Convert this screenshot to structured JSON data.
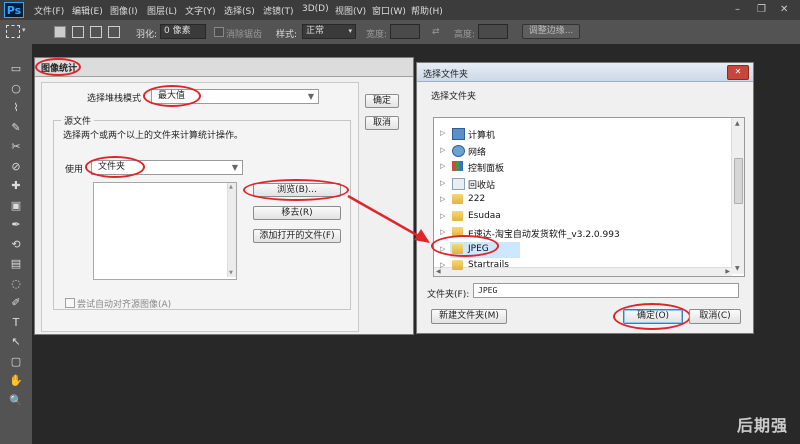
{
  "app": {
    "logo": "Ps"
  },
  "menu": [
    "文件(F)",
    "编辑(E)",
    "图像(I)",
    "图层(L)",
    "文字(Y)",
    "选择(S)",
    "滤镜(T)",
    "3D(D)",
    "视图(V)",
    "窗口(W)",
    "帮助(H)"
  ],
  "window_controls": {
    "minimize": "–",
    "restore": "❐",
    "close": "✕"
  },
  "options": {
    "feather_label": "羽化:",
    "feather_value": "0 像素",
    "antialias_label": "消除锯齿",
    "style_label": "样式:",
    "style_value": "正常",
    "width_label": "宽度:",
    "height_label": "高度:",
    "refine_edge": "调整边缘..."
  },
  "stats_dialog": {
    "title": "图像统计",
    "stack_mode_label": "选择堆栈模式",
    "stack_mode_value": "最大值",
    "ok_label": "确定",
    "cancel_label": "取消",
    "source_group_label": "源文件",
    "source_hint": "选择两个或两个以上的文件来计算统计操作。",
    "use_label": "使用",
    "use_value": "文件夹",
    "browse_label": "浏览(B)...",
    "remove_label": "移去(R)",
    "add_open_label": "添加打开的文件(F)",
    "auto_align_label": "尝试自动对齐源图像(A)"
  },
  "folder_dialog": {
    "title": "选择文件夹",
    "heading": "选择文件夹",
    "tree": [
      {
        "name": "计算机",
        "icon": "computer-icon"
      },
      {
        "name": "网络",
        "icon": "network-icon"
      },
      {
        "name": "控制面板",
        "icon": "control-panel-icon"
      },
      {
        "name": "回收站",
        "icon": "recycle-bin-icon"
      },
      {
        "name": "222",
        "icon": "folder-icon"
      },
      {
        "name": "Esudaa",
        "icon": "folder-icon"
      },
      {
        "name": "E速达-淘宝自动发货软件_v3.2.0.993",
        "icon": "folder-icon"
      },
      {
        "name": "JPEG",
        "icon": "folder-icon",
        "selected": true
      },
      {
        "name": "Startrails",
        "icon": "folder-icon"
      }
    ],
    "folder_label": "文件夹(F):",
    "folder_value": "JPEG",
    "new_folder_label": "新建文件夹(M)",
    "ok_label": "确定(O)",
    "cancel_label": "取消(C)",
    "close_glyph": "✕"
  },
  "toolbar_glyphs": [
    "▭",
    "○",
    "⌇",
    "✎",
    "✂",
    "⊘",
    "✚",
    "▣",
    "✒",
    "⟲",
    "▤",
    "◌",
    "✐",
    "T",
    "↖",
    "▢",
    "✋",
    "🔍"
  ],
  "watermark": "后期强",
  "accent_colors": {
    "annotation_red": "#e0252a",
    "selection_blue": "#cce8ff"
  }
}
